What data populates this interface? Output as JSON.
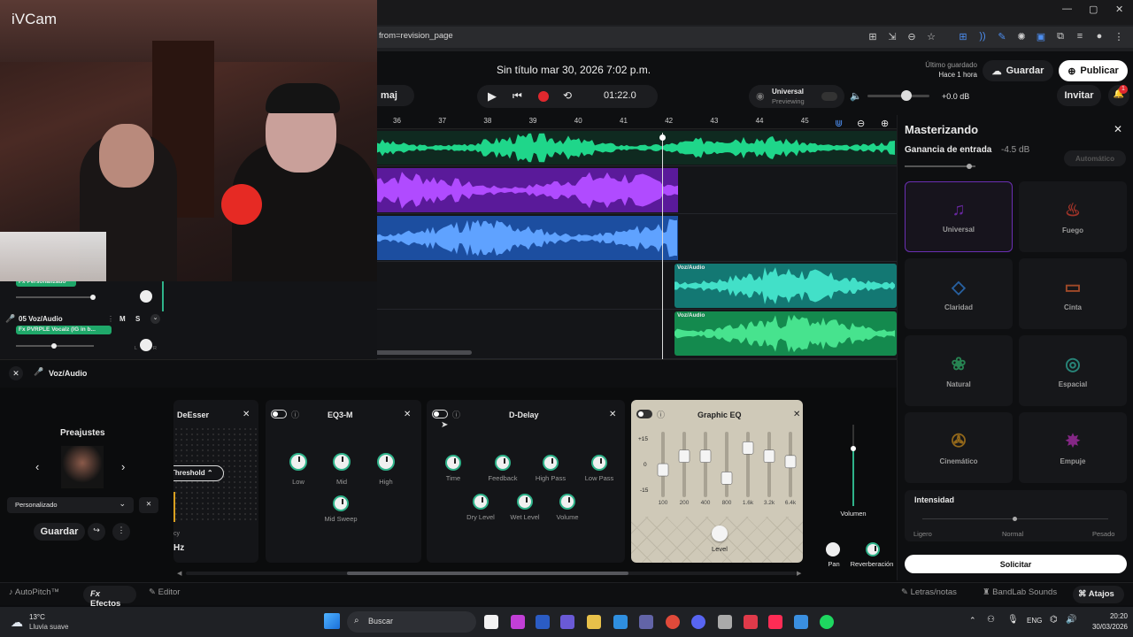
{
  "webcam": {
    "label": "iVCam"
  },
  "browser": {
    "url": "from=revision_page"
  },
  "topbar": {
    "project_title": "Sin título mar 30, 2026 7:02 p.m.",
    "last_saved_label": "Último guardado",
    "last_saved_time": "Hace 1 hora",
    "save_label": "Guardar",
    "publish_label": "Publicar",
    "key_label": "maj",
    "time": "01:22.0",
    "preset_name": "Universal",
    "preset_state": "Previewing",
    "db": "+0.0 dB",
    "invite_label": "Invitar",
    "notif_count": "1"
  },
  "ruler": {
    "ticks": [
      "36",
      "37",
      "38",
      "39",
      "40",
      "41",
      "42",
      "43",
      "44",
      "45"
    ]
  },
  "tracks": {
    "prev_fx": "Fx Personalizado",
    "track_name": "05  Voz/Audio",
    "mute": "M",
    "solo": "S",
    "track_fx": "Fx PVRPLE Vocalz (IG in b...",
    "pan_l": "L",
    "pan_r": "R"
  },
  "clips": {
    "voz_label_1": "Voz/Audio",
    "voz_label_2": "Voz/Audio"
  },
  "fx": {
    "header_track": "Voz/Audio",
    "presets_title": "Preajustes",
    "preset_select": "Personalizado",
    "save_label": "Guardar",
    "deesser": {
      "title": "DeEsser",
      "threshold": "Threshold",
      "cy": "cy",
      "hz": "Hz"
    },
    "eq3": {
      "title": "EQ3-M",
      "knobs": [
        "Low",
        "Mid",
        "High"
      ],
      "sweep": "Mid Sweep"
    },
    "delay": {
      "title": "D-Delay",
      "row1": [
        "Time",
        "Feedback",
        "High Pass",
        "Low Pass"
      ],
      "row2": [
        "Dry Level",
        "Wet Level",
        "Volume"
      ]
    },
    "geq": {
      "title": "Graphic EQ",
      "scale": [
        "+15",
        "0",
        "-15"
      ],
      "bands": [
        "100",
        "200",
        "400",
        "800",
        "1.6k",
        "3.2k",
        "6.4k"
      ],
      "levels": [
        0.45,
        0.7,
        0.7,
        0.3,
        0.85,
        0.7,
        0.6
      ],
      "level_label": "Level"
    },
    "volume_label": "Volumen",
    "pan_label": "Pan",
    "reverb_label": "Reverberación"
  },
  "master": {
    "title": "Masterizando",
    "gain_label": "Ganancia de entrada",
    "gain_value": "-4.5 dB",
    "auto_label": "Automático",
    "presets": [
      {
        "name": "Universal",
        "icon": "music-note-icon",
        "color": "#8a2fd6"
      },
      {
        "name": "Fuego",
        "icon": "fire-icon",
        "color": "#d9402f"
      },
      {
        "name": "Claridad",
        "icon": "diamond-icon",
        "color": "#2f7fd9"
      },
      {
        "name": "Cinta",
        "icon": "tape-icon",
        "color": "#d95f2f"
      },
      {
        "name": "Natural",
        "icon": "lotus-icon",
        "color": "#2fb36a"
      },
      {
        "name": "Espacial",
        "icon": "spiral-icon",
        "color": "#2fb3a0"
      },
      {
        "name": "Cinemático",
        "icon": "film-reel-icon",
        "color": "#c98b1a"
      },
      {
        "name": "Empuje",
        "icon": "burst-icon",
        "color": "#b32fb3"
      }
    ],
    "intensity_title": "Intensidad",
    "intensity_labels": [
      "Ligero",
      "Normal",
      "Pesado"
    ],
    "request_label": "Solicitar"
  },
  "bottom": {
    "autopitch": "AutoPitch™",
    "effects": "Efectos",
    "editor": "Editor",
    "lyrics": "Letras/notas",
    "sounds": "BandLab Sounds",
    "shortcuts": "Atajos"
  },
  "taskbar": {
    "weather_temp": "13°C",
    "weather_desc": "Lluvia suave",
    "search": "Buscar",
    "lang": "ENG",
    "time": "20:20",
    "date": "30/03/2026"
  },
  "colors": {
    "accent": "#2fb38a",
    "purple": "#8a2fd6",
    "blue": "#2e6fd9",
    "green": "#1fa86a",
    "teal": "#1a8c86"
  }
}
